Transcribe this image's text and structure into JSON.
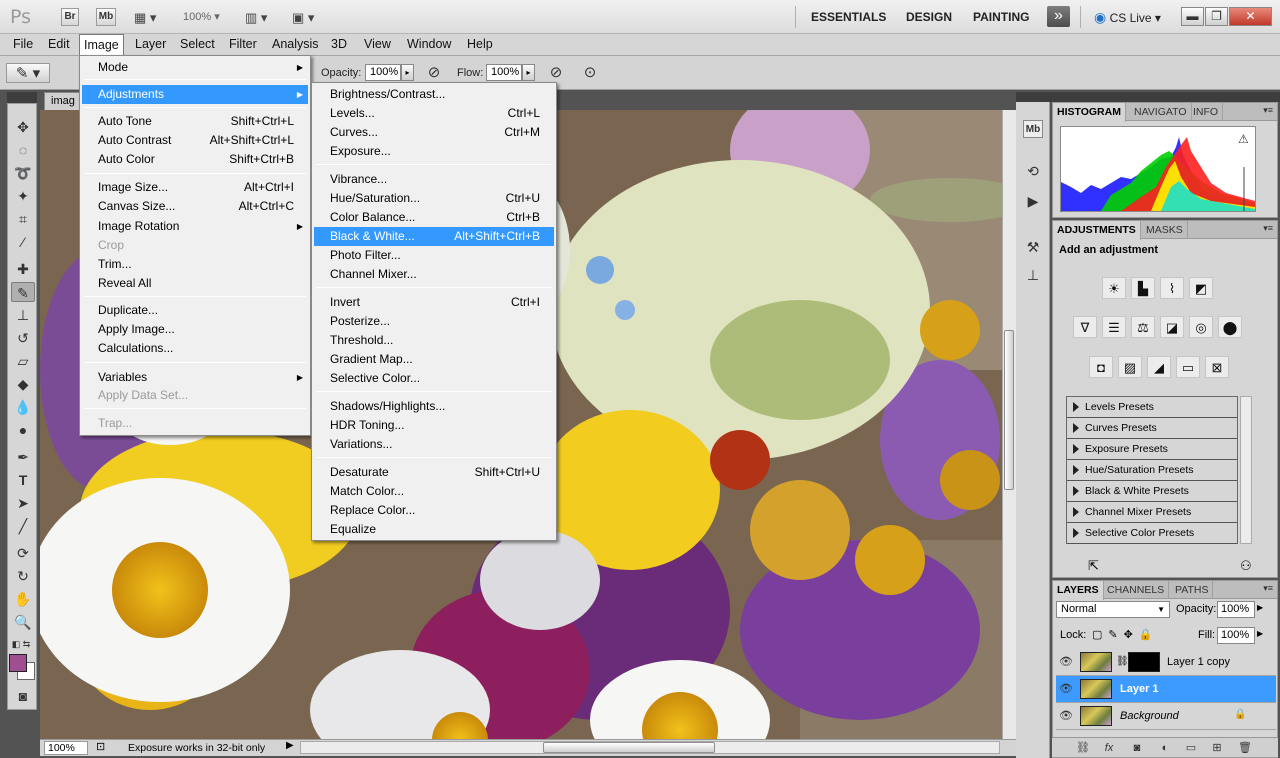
{
  "app": {
    "logo": "Ps",
    "bridge_btn": "Br",
    "minibridge_btn": "Mb",
    "zoom": "100%",
    "workspaces": [
      "ESSENTIALS",
      "DESIGN",
      "PAINTING"
    ],
    "more": "»",
    "cs_live": "CS Live",
    "window_buttons": {
      "minimize": "▬",
      "restore": "❐",
      "close": "✕"
    }
  },
  "menubar": [
    "File",
    "Edit",
    "Image",
    "Layer",
    "Select",
    "Filter",
    "Analysis",
    "3D",
    "View",
    "Window",
    "Help"
  ],
  "options": {
    "opacity_label": "Opacity:",
    "opacity_value": "100%",
    "flow_label": "Flow:",
    "flow_value": "100%"
  },
  "document": {
    "tab_label": "imag",
    "zoom_value": "100%",
    "status_text": "Exposure works in 32-bit only"
  },
  "image_menu": [
    {
      "label": "Mode",
      "submenu": true
    },
    {
      "label": "Adjustments",
      "submenu": true,
      "highlight": true
    },
    {
      "label": "Auto Tone",
      "shortcut": "Shift+Ctrl+L"
    },
    {
      "label": "Auto Contrast",
      "shortcut": "Alt+Shift+Ctrl+L"
    },
    {
      "label": "Auto Color",
      "shortcut": "Shift+Ctrl+B"
    },
    {
      "label": "Image Size...",
      "shortcut": "Alt+Ctrl+I"
    },
    {
      "label": "Canvas Size...",
      "shortcut": "Alt+Ctrl+C"
    },
    {
      "label": "Image Rotation",
      "submenu": true
    },
    {
      "label": "Crop",
      "disabled": true
    },
    {
      "label": "Trim..."
    },
    {
      "label": "Reveal All"
    },
    {
      "label": "Duplicate..."
    },
    {
      "label": "Apply Image..."
    },
    {
      "label": "Calculations..."
    },
    {
      "label": "Variables",
      "submenu": true
    },
    {
      "label": "Apply Data Set...",
      "disabled": true
    },
    {
      "label": "Trap...",
      "disabled": true
    }
  ],
  "adjustments_menu": [
    {
      "label": "Brightness/Contrast..."
    },
    {
      "label": "Levels...",
      "shortcut": "Ctrl+L"
    },
    {
      "label": "Curves...",
      "shortcut": "Ctrl+M"
    },
    {
      "label": "Exposure..."
    },
    {
      "label": "Vibrance..."
    },
    {
      "label": "Hue/Saturation...",
      "shortcut": "Ctrl+U"
    },
    {
      "label": "Color Balance...",
      "shortcut": "Ctrl+B"
    },
    {
      "label": "Black & White...",
      "shortcut": "Alt+Shift+Ctrl+B",
      "highlight": true
    },
    {
      "label": "Photo Filter..."
    },
    {
      "label": "Channel Mixer..."
    },
    {
      "label": "Invert",
      "shortcut": "Ctrl+I"
    },
    {
      "label": "Posterize..."
    },
    {
      "label": "Threshold..."
    },
    {
      "label": "Gradient Map..."
    },
    {
      "label": "Selective Color..."
    },
    {
      "label": "Shadows/Highlights..."
    },
    {
      "label": "HDR Toning..."
    },
    {
      "label": "Variations..."
    },
    {
      "label": "Desaturate",
      "shortcut": "Shift+Ctrl+U"
    },
    {
      "label": "Match Color..."
    },
    {
      "label": "Replace Color..."
    },
    {
      "label": "Equalize"
    }
  ],
  "panels": {
    "histogram_tabs": [
      "HISTOGRAM",
      "NAVIGATO",
      "INFO"
    ],
    "adjustments_tabs": [
      "ADJUSTMENTS",
      "MASKS"
    ],
    "add_adjustment": "Add an adjustment",
    "presets": [
      "Levels Presets",
      "Curves Presets",
      "Exposure Presets",
      "Hue/Saturation Presets",
      "Black & White Presets",
      "Channel Mixer Presets",
      "Selective Color Presets"
    ],
    "layers_tabs": [
      "LAYERS",
      "CHANNELS",
      "PATHS"
    ],
    "blend_mode": "Normal",
    "opacity_label": "Opacity:",
    "opacity_value": "100%",
    "lock_label": "Lock:",
    "fill_label": "Fill:",
    "fill_value": "100%",
    "layers": [
      {
        "name": "Layer 1 copy",
        "selected": false,
        "has_mask": true
      },
      {
        "name": "Layer 1",
        "selected": true
      },
      {
        "name": "Background",
        "selected": false,
        "locked": true
      }
    ]
  },
  "colors": {
    "accent": "#3399ff",
    "foreground": "#9f4f90",
    "background": "#ffffff"
  }
}
